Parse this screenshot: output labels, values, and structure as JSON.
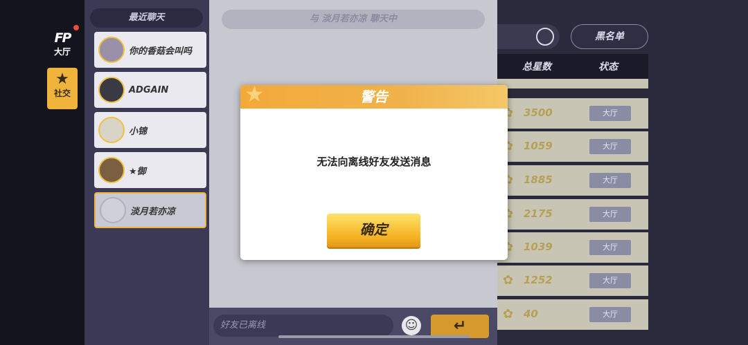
{
  "nav": {
    "logo": "FP",
    "lobby_label": "大厅",
    "social_label": "社交"
  },
  "friend_list": {
    "title": "最近聊天",
    "friends": [
      {
        "name": "你的香菇会叫吗",
        "avatar_color": "#9a90a8"
      },
      {
        "name": "ADGAIN",
        "avatar_color": "#3a3a44"
      },
      {
        "name": "小锦",
        "avatar_color": "#d8d4c8"
      },
      {
        "name": "★御",
        "avatar_color": "#7a6040"
      },
      {
        "name": "淡月若亦凉",
        "avatar_color": "#d0d0d8"
      }
    ]
  },
  "chat": {
    "header": "与 淡月若亦凉 聊天中",
    "input_placeholder": "好友已离线",
    "send_icon": "↵"
  },
  "right": {
    "blacklist_label": "黑名单",
    "col_stars": "总星数",
    "col_status": "状态",
    "rows": [
      {
        "stars": "3500",
        "status": "大厅"
      },
      {
        "stars": "1059",
        "status": "大厅"
      },
      {
        "stars": "1885",
        "status": "大厅"
      },
      {
        "stars": "2175",
        "status": "大厅"
      },
      {
        "stars": "1039",
        "status": "大厅"
      },
      {
        "stars": "1252",
        "status": "大厅"
      },
      {
        "stars": "40",
        "status": "大厅"
      }
    ]
  },
  "dialog": {
    "title": "警告",
    "message": "无法向离线好友发送消息",
    "confirm_label": "确定"
  }
}
